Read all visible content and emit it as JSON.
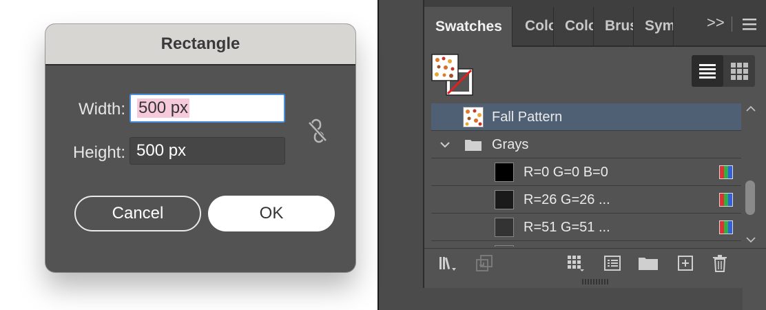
{
  "dialog": {
    "title": "Rectangle",
    "width_label": "Width:",
    "width_value": "500 px",
    "height_label": "Height:",
    "height_value": "500 px",
    "constrain_icon": "unlink-icon",
    "cancel_label": "Cancel",
    "ok_label": "OK"
  },
  "panel": {
    "tabs": [
      {
        "label": "Swatches",
        "active": true
      },
      {
        "label": "Colo",
        "active": false
      },
      {
        "label": "Colo",
        "active": false
      },
      {
        "label": "Brus",
        "active": false
      },
      {
        "label": "Sym",
        "active": false
      }
    ],
    "overflow_icon": ">>",
    "menu_icon": "hamburger-icon",
    "list": [
      {
        "type": "swatch",
        "name": "Fall Pattern",
        "selected": true,
        "chip": "pattern"
      },
      {
        "type": "group",
        "name": "Grays",
        "expanded": true
      },
      {
        "type": "color",
        "name": "R=0 G=0 B=0",
        "color": "#000000"
      },
      {
        "type": "color",
        "name": "R=26 G=26 ...",
        "color": "#1a1a1a"
      },
      {
        "type": "color",
        "name": "R=51 G=51 ...",
        "color": "#333333"
      }
    ],
    "colors": {
      "selected_row": "#4f6075",
      "panel_bg": "#535353",
      "tab_bg": "#3f3f3f",
      "accent": "#4a8fe0"
    }
  }
}
